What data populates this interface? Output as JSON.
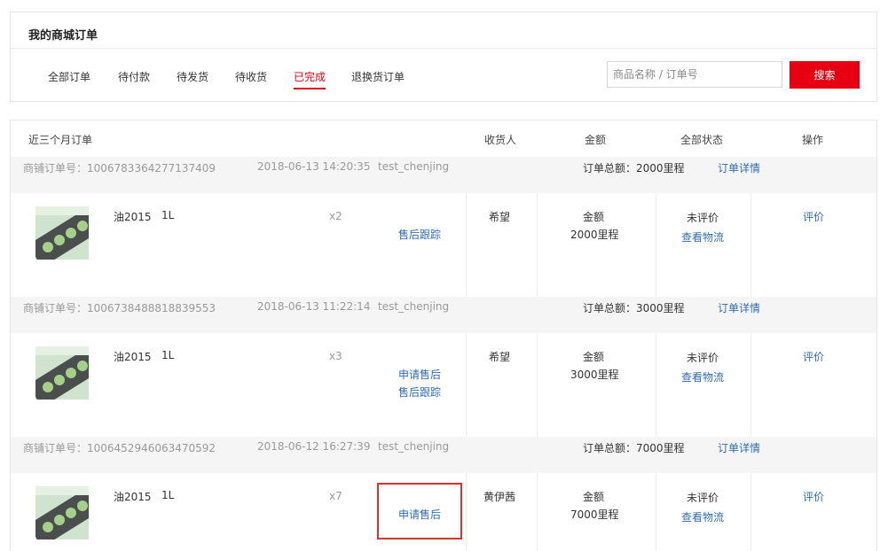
{
  "header": {
    "title": "我的商城订单",
    "tabs": [
      {
        "label": "全部订单",
        "active": false
      },
      {
        "label": "待付款",
        "active": false
      },
      {
        "label": "待发货",
        "active": false
      },
      {
        "label": "待收货",
        "active": false
      },
      {
        "label": "已完成",
        "active": true
      },
      {
        "label": "退换货订单",
        "active": false
      }
    ],
    "search": {
      "placeholder": "商品名称 / 订单号",
      "value": "",
      "button_label": "搜索"
    }
  },
  "list": {
    "columns": {
      "orders": "近三个月订单",
      "receiver": "收货人",
      "amount": "金额",
      "status": "全部状态",
      "action": "操作"
    },
    "orders": [
      {
        "order_no": "商铺订单号：1006783364277137409",
        "datetime": "2018-06-13 14:20:35",
        "user": "test_chenjing",
        "total": "订单总额：2000里程",
        "detail_link": "订单详情",
        "product_name": "油2015",
        "spec": "1L",
        "qty": "x2",
        "after_sale": [
          "售后跟踪"
        ],
        "receiver": "希望",
        "amount_label": "金额",
        "amount_value": "2000里程",
        "status": "未评价",
        "logistics": "查看物流",
        "action": "评价"
      },
      {
        "order_no": "商铺订单号：1006738488818839553",
        "datetime": "2018-06-13 11:22:14",
        "user": "test_chenjing",
        "total": "订单总额：3000里程",
        "detail_link": "订单详情",
        "product_name": "油2015",
        "spec": "1L",
        "qty": "x3",
        "after_sale": [
          "申请售后",
          "售后跟踪"
        ],
        "receiver": "希望",
        "amount_label": "金额",
        "amount_value": "3000里程",
        "status": "未评价",
        "logistics": "查看物流",
        "action": "评价"
      },
      {
        "order_no": "商铺订单号：1006452946063470592",
        "datetime": "2018-06-12 16:27:39",
        "user": "test_chenjing",
        "total": "订单总额：7000里程",
        "detail_link": "订单详情",
        "product_name": "油2015",
        "spec": "1L",
        "qty": "x7",
        "after_sale": [
          "申请售后"
        ],
        "receiver": "黄伊茜",
        "amount_label": "金额",
        "amount_value": "7000里程",
        "status": "未评价",
        "logistics": "查看物流",
        "action": "评价"
      }
    ]
  },
  "colors": {
    "accent": "#e60012",
    "link": "#2f6cb0",
    "highlight": "#d9342b"
  }
}
